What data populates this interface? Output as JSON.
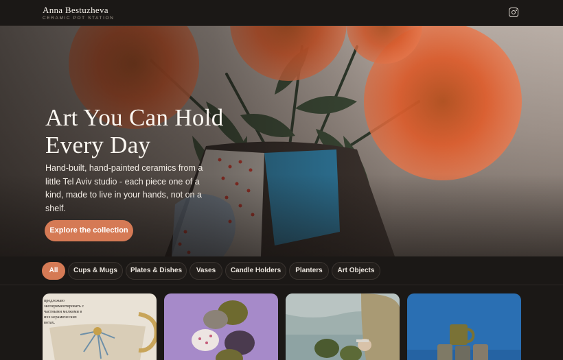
{
  "header": {
    "brand_name": "Anna Bestuzheva",
    "brand_tagline": "CERAMIC POT STATION",
    "social_icon": "instagram-icon"
  },
  "hero": {
    "title": "Art You Can Hold Every Day",
    "subtitle": "Hand-built, hand-painted ceramics from a little Tel Aviv studio - each piece one of a kind, made to live in your hands, not on a shelf.",
    "cta_label": "Explore the collection",
    "colors": {
      "accent": "#d57a55",
      "flower": "#e05a32"
    }
  },
  "filters": {
    "items": [
      {
        "label": "All",
        "active": true
      },
      {
        "label": "Cups & Mugs",
        "active": false
      },
      {
        "label": "Plates & Dishes",
        "active": false
      },
      {
        "label": "Vases",
        "active": false
      },
      {
        "label": "Candle Holders",
        "active": false
      },
      {
        "label": "Planters",
        "active": false
      },
      {
        "label": "Art Objects",
        "active": false
      }
    ]
  },
  "products": {
    "cards": [
      {
        "image": "cup-with-russian-text",
        "caption_lines": [
          "предложаю",
          "экспериментировать с",
          "частными мелкими в",
          "ихх керамических",
          "вотах."
        ]
      },
      {
        "image": "mugs-on-purple"
      },
      {
        "image": "mugs-by-sea"
      },
      {
        "image": "olive-mugs-on-blue"
      }
    ]
  }
}
